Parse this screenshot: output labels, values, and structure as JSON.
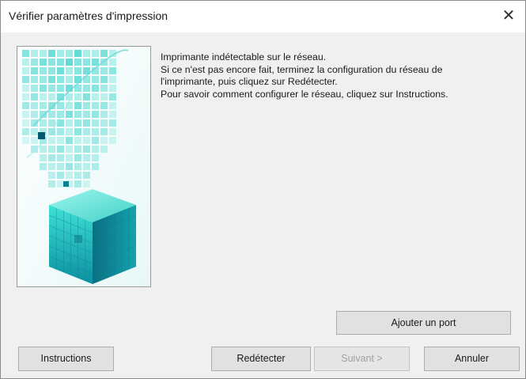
{
  "window": {
    "title": "Vérifier paramètres d'impression",
    "close_glyph": "✕"
  },
  "illustration": {
    "icon": "canon-cube-graphic",
    "colors": {
      "primary": "#2ec8c0",
      "dark": "#0a6f82",
      "light": "#bff2ee"
    }
  },
  "message": {
    "lines": [
      "Imprimante indétectable sur le réseau.",
      "Si ce n'est pas encore fait, terminez la configuration du réseau de",
      "l'imprimante, puis cliquez sur Redétecter.",
      "Pour savoir comment configurer le réseau, cliquez sur Instructions."
    ]
  },
  "buttons": {
    "add_port": "Ajouter un port",
    "instructions": "Instructions",
    "redetect": "Redétecter",
    "next": "Suivant >",
    "cancel": "Annuler"
  }
}
